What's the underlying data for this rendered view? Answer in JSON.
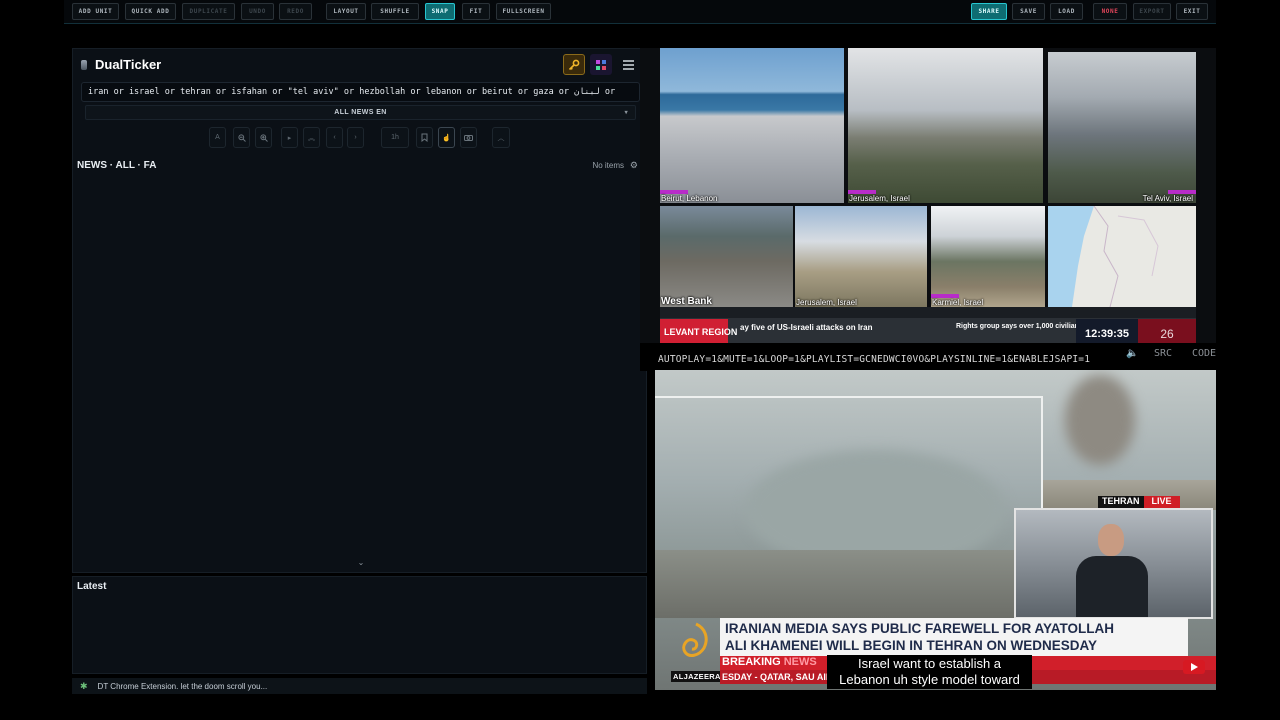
{
  "toolbar": {
    "add_unit": "ADD UNIT",
    "quick_add": "QUICK ADD",
    "duplicate": "DUPLICATE",
    "undo": "UNDO",
    "redo": "REDO",
    "layout": "LAYOUT",
    "shuffle": "SHUFFLE",
    "snap": "SNAP",
    "fit": "FIT",
    "fullscreen": "FULLSCREEN",
    "share": "SHARE",
    "save": "SAVE",
    "load": "LOAD",
    "none": "NONE",
    "export": "EXPORT",
    "exit": "EXIT"
  },
  "ticker_panel": {
    "brand": "DualTicker",
    "query": "iran or israel or tehran or isfahan or \"tel aviv\" or hezbollah or lebanon or beirut or gaza or لبنان or",
    "feed_select": "ALL NEWS EN",
    "controls": {
      "font": "A",
      "timeframe": "1h"
    },
    "news_header": "NEWS · ALL · FA",
    "news_count": "No items",
    "latest_header": "Latest",
    "status_text": "DT Chrome Extension. let the doom scroll you..."
  },
  "cameras": [
    {
      "label": "Beirut, Lebanon"
    },
    {
      "label": "Jerusalem, Israel"
    },
    {
      "label": "Tel Aviv, Israel"
    },
    {
      "label": "West Bank"
    },
    {
      "label": "Jerusalem, Israel"
    },
    {
      "label": "Karmiel, Israel"
    },
    {
      "label": ""
    }
  ],
  "cam_ticker": {
    "region": "LEVANT REGION",
    "headline": "ay five of US-Israeli attacks on Iran",
    "headline2": "Rights group says over 1,000 civilians killed in Iran si",
    "clock": "12:39:35",
    "date": "26"
  },
  "embed": {
    "url": "AUTOPLAY=1&MUTE=1&LOOP=1&PLAYLIST=GCNEDWCI0VO&PLAYSINLINE=1&ENABLEJSAPI=1",
    "src": "SRC",
    "code": "CODE"
  },
  "video": {
    "city": "TEHRAN",
    "live": "LIVE",
    "headline_line1": "IRANIAN MEDIA SAYS PUBLIC FAREWELL FOR AYATOLLAH",
    "headline_line2": "ALI KHAMENEI WILL BEGIN IN TEHRAN ON WEDNESDAY",
    "breaking": "BREAKING",
    "breaking2": "NEWS",
    "crawl": "ESDAY  -  QATAR, SAU                                                     AIR ATTACKS OVERNIGHT  -  Subscribe A",
    "caption_line1": "Israel want to establish a",
    "caption_line2": "Lebanon uh style model toward",
    "logo_text": "ALJAZEERA"
  },
  "colors": {
    "accent": "#0e6c72",
    "accent_border": "#27c6d1",
    "danger": "#e0455a",
    "panel": "#0b1016",
    "aj_red": "#d11f2a"
  }
}
